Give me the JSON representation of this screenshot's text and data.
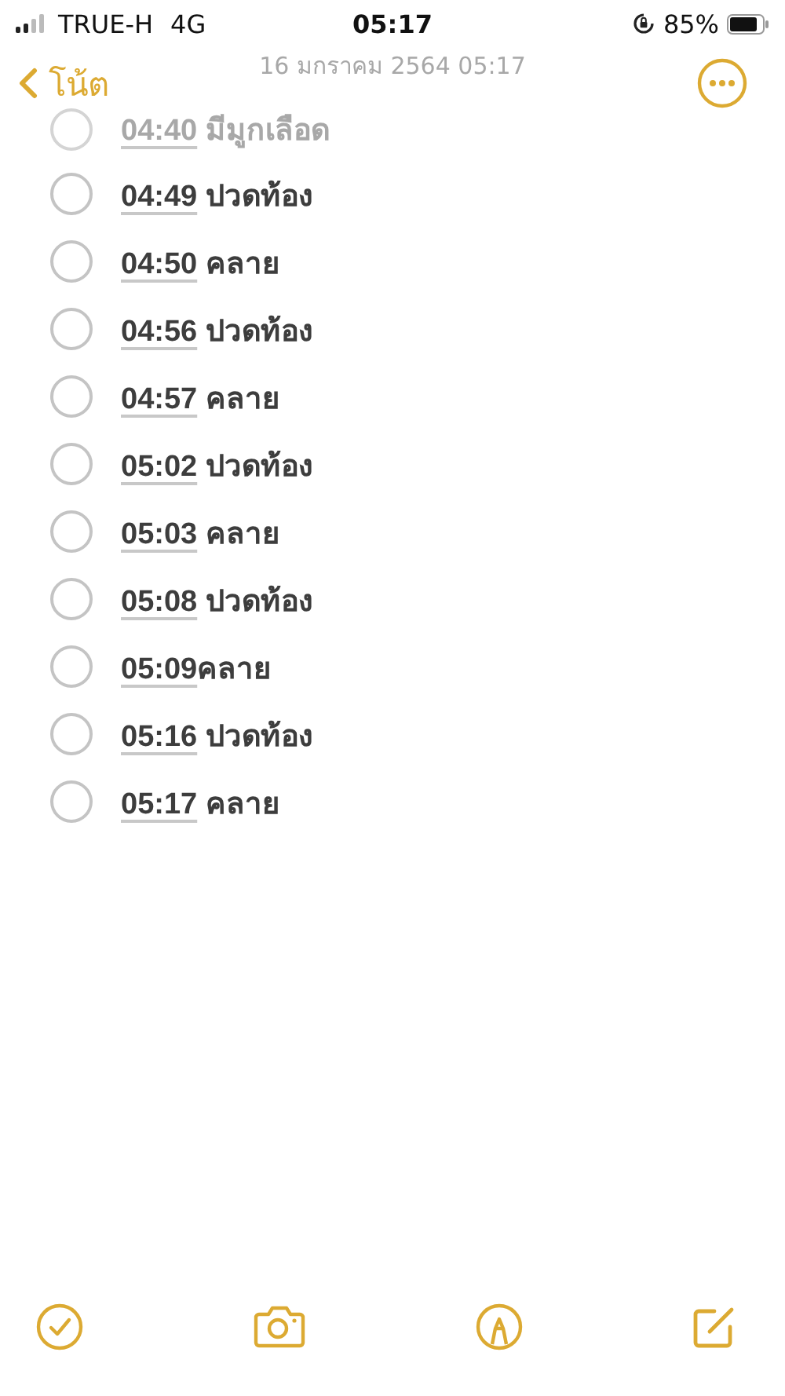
{
  "status_bar": {
    "carrier": "TRUE-H",
    "network": "4G",
    "time": "05:17",
    "battery": "85%"
  },
  "nav": {
    "back": "โน้ต"
  },
  "note": {
    "date": "16 มกราคม 2564 05:17",
    "items": [
      {
        "time": "04:40",
        "text": "มีมูกเลือด",
        "spaced": true,
        "checked": false,
        "faded": true
      },
      {
        "time": "04:49",
        "text": "ปวดท้อง",
        "spaced": true,
        "checked": false,
        "faded": false
      },
      {
        "time": "04:50",
        "text": "คลาย",
        "spaced": true,
        "checked": false,
        "faded": false
      },
      {
        "time": "04:56",
        "text": "ปวดท้อง",
        "spaced": true,
        "checked": false,
        "faded": false
      },
      {
        "time": "04:57",
        "text": "คลาย",
        "spaced": true,
        "checked": false,
        "faded": false
      },
      {
        "time": "05:02",
        "text": "ปวดท้อง",
        "spaced": true,
        "checked": false,
        "faded": false
      },
      {
        "time": "05:03",
        "text": "คลาย",
        "spaced": true,
        "checked": false,
        "faded": false
      },
      {
        "time": "05:08",
        "text": "ปวดท้อง",
        "spaced": true,
        "checked": false,
        "faded": false
      },
      {
        "time": "05:09",
        "text": "คลาย",
        "spaced": false,
        "checked": false,
        "faded": false
      },
      {
        "time": "05:16",
        "text": "ปวดท้อง",
        "spaced": true,
        "checked": false,
        "faded": false
      },
      {
        "time": "05:17",
        "text": "คลาย",
        "spaced": true,
        "checked": false,
        "faded": false
      }
    ]
  }
}
